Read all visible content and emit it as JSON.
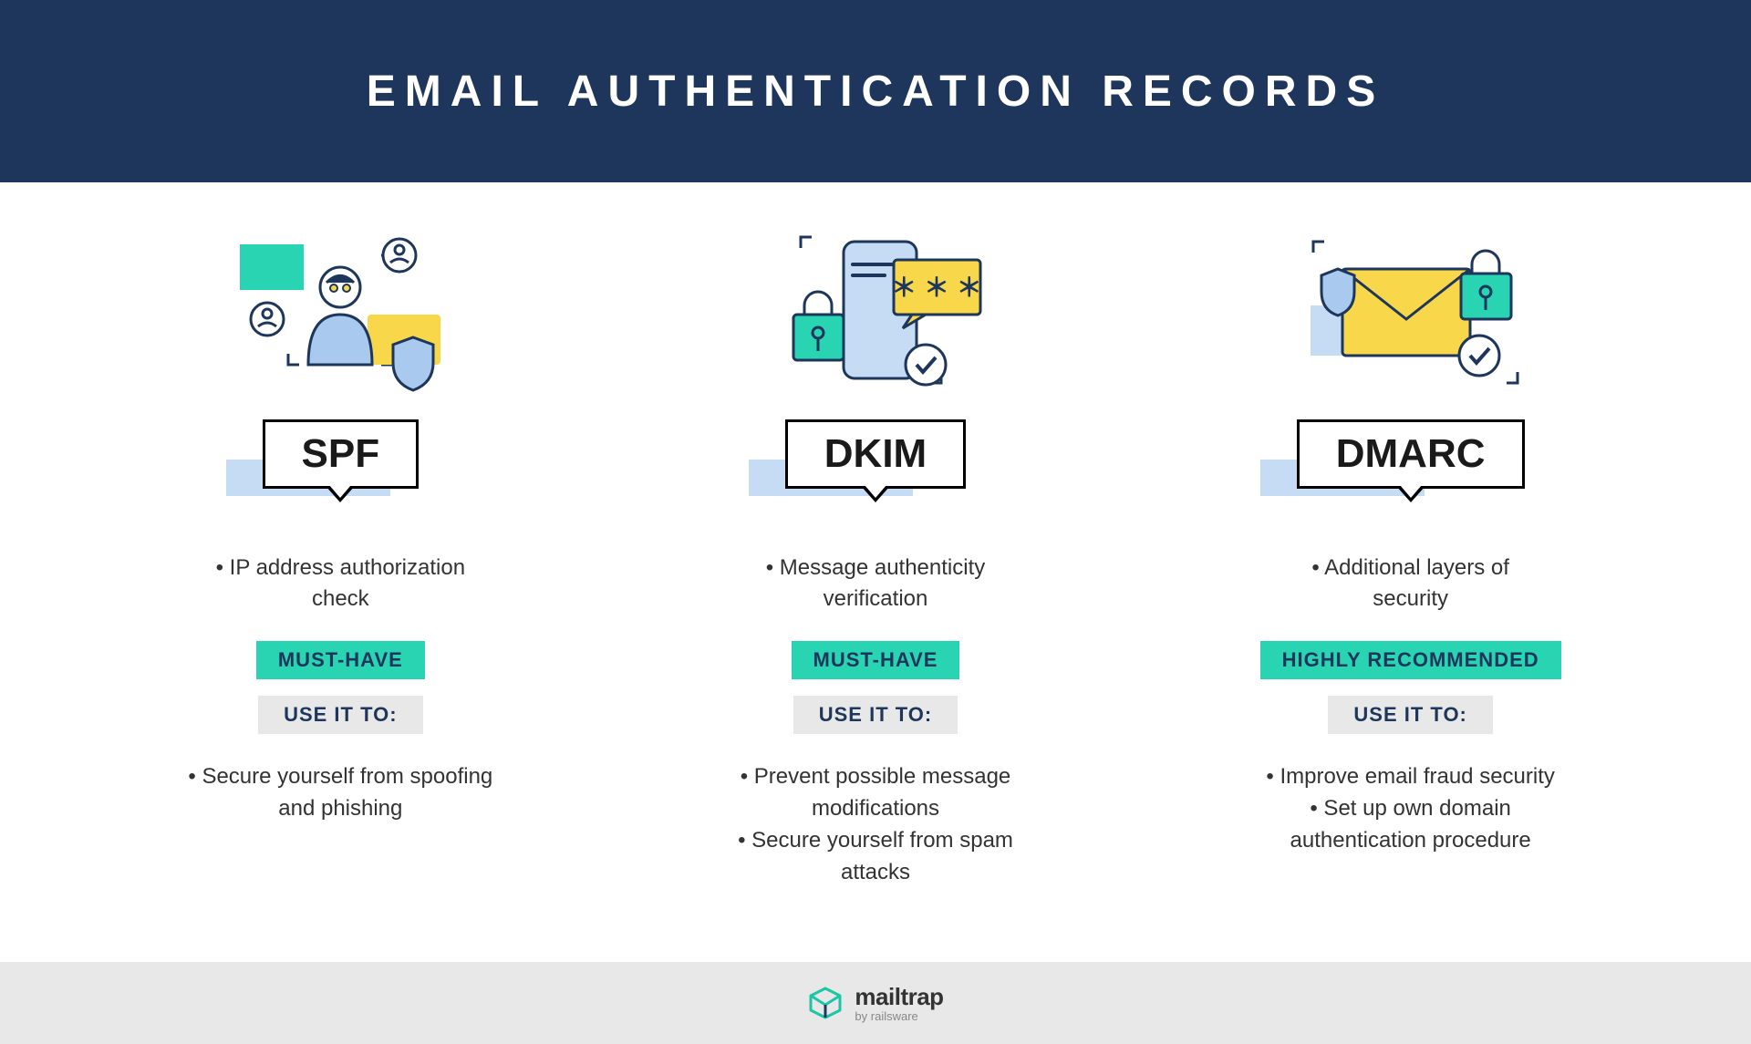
{
  "title": "EMAIL AUTHENTICATION RECORDS",
  "colors": {
    "navy": "#1e365c",
    "teal": "#29d4b2",
    "yellow": "#f8d84a",
    "lightblue": "#c6dcf5",
    "gray": "#e8e8e8"
  },
  "use_it_to_label": "USE IT TO:",
  "records": [
    {
      "name": "SPF",
      "description": "• IP address authorization check",
      "priority": "MUST-HAVE",
      "uses": "• Secure yourself from spoofing and phishing"
    },
    {
      "name": "DKIM",
      "description": "• Message authenticity verification",
      "priority": "MUST-HAVE",
      "uses": "• Prevent possible message modifications\n• Secure yourself from spam attacks"
    },
    {
      "name": "DMARC",
      "description": "• Additional layers of security",
      "priority": "HIGHLY RECOMMENDED",
      "uses": "• Improve email fraud security\n• Set up own domain authentication procedure"
    }
  ],
  "footer": {
    "brand": "mailtrap",
    "byline": "by railsware"
  }
}
